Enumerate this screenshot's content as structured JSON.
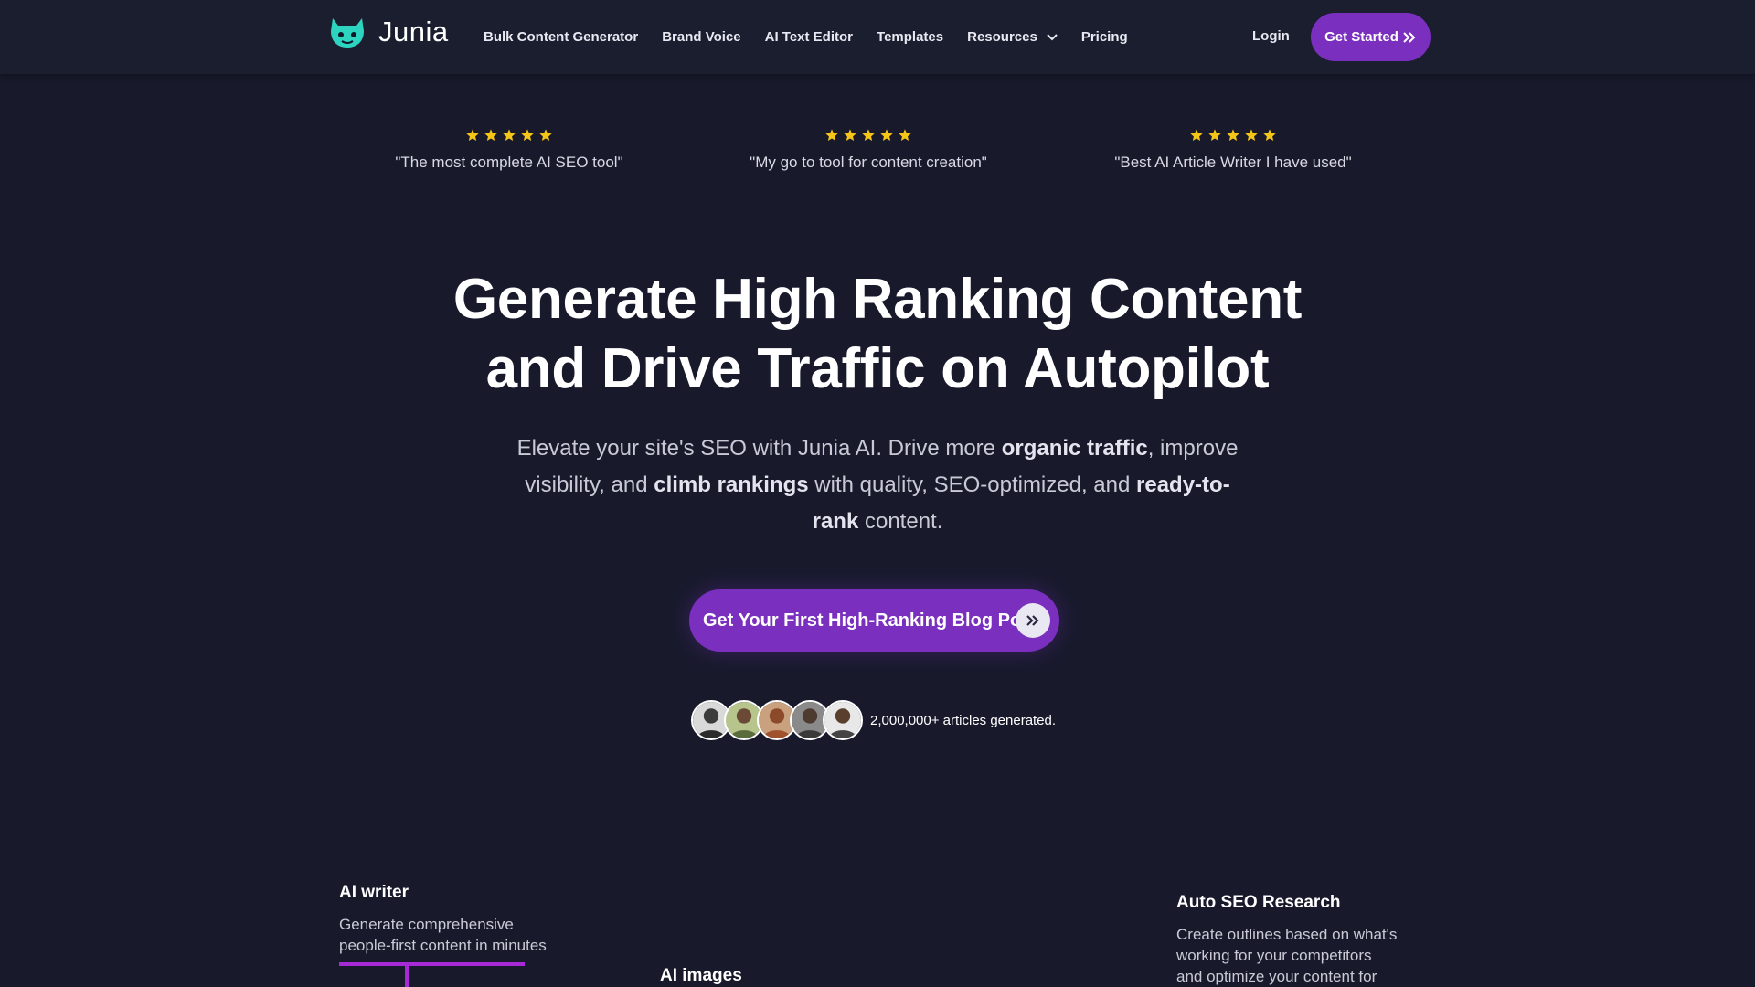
{
  "brand": {
    "name": "Junia"
  },
  "nav": {
    "links": [
      "Bulk Content Generator",
      "Brand Voice",
      "AI Text Editor",
      "Templates",
      "Resources",
      "Pricing"
    ],
    "login": "Login",
    "cta": "Get Started"
  },
  "testimonials": [
    {
      "rating": 5,
      "quote": "\"The most complete AI SEO tool\""
    },
    {
      "rating": 5,
      "quote": "\"My go to tool for content creation\""
    },
    {
      "rating": 5,
      "quote": "\"Best AI Article Writer I have used\""
    }
  ],
  "hero": {
    "title_line1": "Generate High Ranking Content",
    "title_line2": "and Drive Traffic on Autopilot",
    "subtitle": {
      "p1": "Elevate your site's SEO with Junia AI. Drive more ",
      "b1": "organic traffic",
      "p2": ", improve visibility, and ",
      "b2": "climb rankings",
      "p3": " with quality, SEO-optimized, and ",
      "b3": "ready-to-rank",
      "p4": " content."
    },
    "cta": "Get Your First High-Ranking Blog Post",
    "social_proof": "2,000,000+ articles generated."
  },
  "features": {
    "ai_writer": {
      "title": "AI writer",
      "desc1": "Generate comprehensive",
      "desc2": "people-first content in minutes"
    },
    "ai_images": {
      "title": "AI images"
    },
    "auto_seo": {
      "title": "Auto SEO Research",
      "desc1": "Create outlines based on what's",
      "desc2": "working for your competitors",
      "desc3": "and optimize your content for"
    }
  },
  "colors": {
    "background": "#181a2c",
    "nav_bg": "#1b1e2f",
    "accent": "#7b2fbf",
    "star": "#f5c518",
    "bar": "#a62ad6"
  },
  "icons": [
    "junia-logo-icon",
    "chevron-down-icon",
    "double-chevron-right-icon",
    "star-icon",
    "avatar-icon"
  ]
}
